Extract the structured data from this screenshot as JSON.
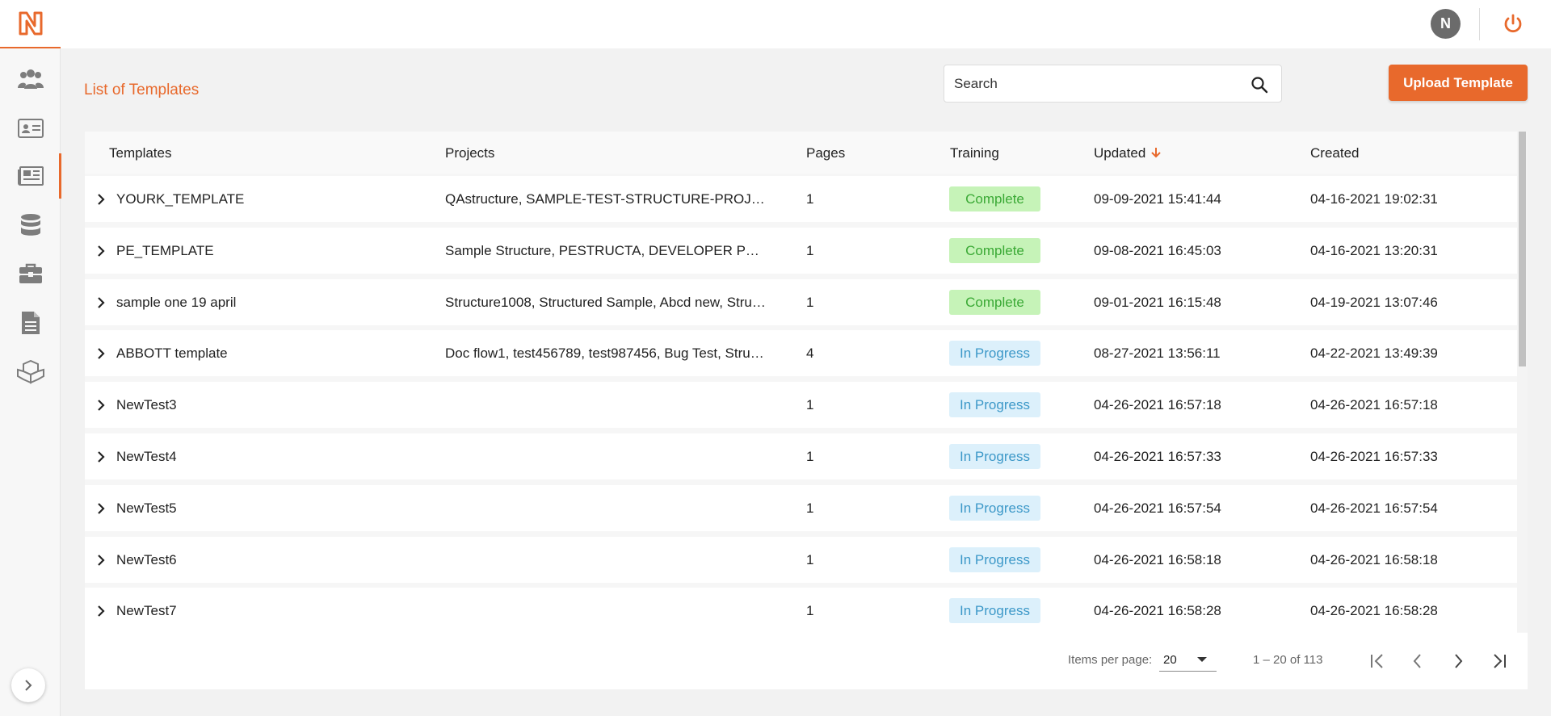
{
  "brand": {
    "accent": "#e8692c",
    "logo_letter": "N"
  },
  "sidebar": {
    "items": [
      {
        "name": "users-icon"
      },
      {
        "name": "id-card-icon"
      },
      {
        "name": "newspaper-icon",
        "active": true
      },
      {
        "name": "database-icon"
      },
      {
        "name": "briefcase-icon"
      },
      {
        "name": "document-icon"
      },
      {
        "name": "cubes-icon"
      }
    ],
    "collapse": "chevron-right-icon"
  },
  "topbar": {
    "avatar_initial": "N",
    "power": "power-icon"
  },
  "header": {
    "title": "List of Templates",
    "search_placeholder": "Search",
    "upload_label": "Upload Template"
  },
  "table": {
    "columns": [
      "Templates",
      "Projects",
      "Pages",
      "Training",
      "Updated",
      "Created"
    ],
    "sorted_column": "Updated",
    "sort_direction": "descending",
    "rows": [
      {
        "template": "YOURK_TEMPLATE",
        "projects": "QAstructure, SAMPLE-TEST-STRUCTURE-PROJ…",
        "pages": "1",
        "training": "Complete",
        "status": "complete",
        "updated": "09-09-2021 15:41:44",
        "created": "04-16-2021 19:02:31"
      },
      {
        "template": "PE_TEMPLATE",
        "projects": "Sample Structure, PESTRUCTA, DEVELOPER P…",
        "pages": "1",
        "training": "Complete",
        "status": "complete",
        "updated": "09-08-2021 16:45:03",
        "created": "04-16-2021 13:20:31"
      },
      {
        "template": "sample one 19 april",
        "projects": "Structure1008, Structured Sample, Abcd new, Stru…",
        "pages": "1",
        "training": "Complete",
        "status": "complete",
        "updated": "09-01-2021 16:15:48",
        "created": "04-19-2021 13:07:46"
      },
      {
        "template": "ABBOTT template",
        "projects": "Doc flow1, test456789, test987456, Bug Test, Stru…",
        "pages": "4",
        "training": "In Progress",
        "status": "progress",
        "updated": "08-27-2021 13:56:11",
        "created": "04-22-2021 13:49:39"
      },
      {
        "template": "NewTest3",
        "projects": "",
        "pages": "1",
        "training": "In Progress",
        "status": "progress",
        "updated": "04-26-2021 16:57:18",
        "created": "04-26-2021 16:57:18"
      },
      {
        "template": "NewTest4",
        "projects": "",
        "pages": "1",
        "training": "In Progress",
        "status": "progress",
        "updated": "04-26-2021 16:57:33",
        "created": "04-26-2021 16:57:33"
      },
      {
        "template": "NewTest5",
        "projects": "",
        "pages": "1",
        "training": "In Progress",
        "status": "progress",
        "updated": "04-26-2021 16:57:54",
        "created": "04-26-2021 16:57:54"
      },
      {
        "template": "NewTest6",
        "projects": "",
        "pages": "1",
        "training": "In Progress",
        "status": "progress",
        "updated": "04-26-2021 16:58:18",
        "created": "04-26-2021 16:58:18"
      },
      {
        "template": "NewTest7",
        "projects": "",
        "pages": "1",
        "training": "In Progress",
        "status": "progress",
        "updated": "04-26-2021 16:58:28",
        "created": "04-26-2021 16:58:28"
      }
    ]
  },
  "paginator": {
    "items_per_page_label": "Items per page:",
    "items_per_page": "20",
    "range_label": "1 – 20 of 113"
  }
}
